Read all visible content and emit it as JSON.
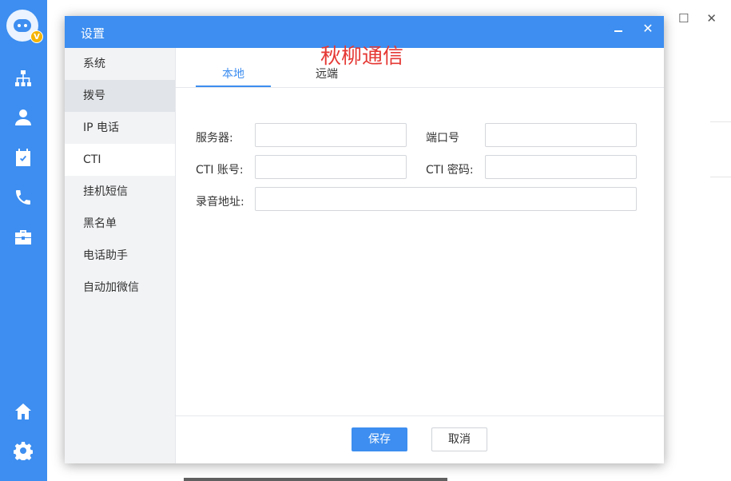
{
  "app": {
    "avatar_badge": "V"
  },
  "colors": {
    "primary": "#3d8ef0",
    "watermark": "#e53935"
  },
  "rail_icons": [
    "org-chart-icon",
    "user-icon",
    "calendar-check-icon",
    "phone-icon",
    "briefcase-icon",
    "home-icon",
    "gear-icon"
  ],
  "dialog": {
    "title": "设置",
    "watermark": "秋柳通信",
    "close_glyph": "✕"
  },
  "sidebar": {
    "items": [
      {
        "label": "系统"
      },
      {
        "label": "拨号"
      },
      {
        "label": "IP 电话"
      },
      {
        "label": "CTI"
      },
      {
        "label": "挂机短信"
      },
      {
        "label": "黑名单"
      },
      {
        "label": "电话助手"
      },
      {
        "label": "自动加微信"
      }
    ],
    "selected": "CTI"
  },
  "tabs": [
    {
      "label": "本地"
    },
    {
      "label": "远端"
    }
  ],
  "form": {
    "server_label": "服务器:",
    "server_value": "",
    "port_label": "端口号",
    "port_value": "",
    "cti_account_label": "CTI 账号:",
    "cti_account_value": "",
    "cti_password_label": "CTI 密码:",
    "cti_password_value": "",
    "recording_label": "录音地址:",
    "recording_value": ""
  },
  "footer": {
    "save_label": "保存",
    "cancel_label": "取消"
  }
}
